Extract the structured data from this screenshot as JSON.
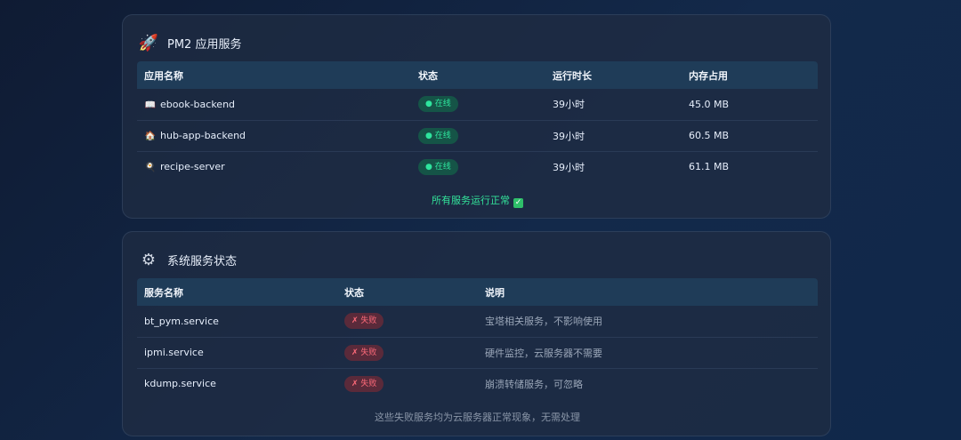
{
  "pm2": {
    "title": "PM2 应用服务",
    "icon": "rocket-icon",
    "columns": [
      "应用名称",
      "状态",
      "运行时长",
      "内存占用"
    ],
    "rows": [
      {
        "icon": "book-icon",
        "name": "ebook-backend",
        "status": "● 在线",
        "uptime": "39小时",
        "memory": "45.0 MB"
      },
      {
        "icon": "house-icon",
        "name": "hub-app-backend",
        "status": "● 在线",
        "uptime": "39小时",
        "memory": "60.5 MB"
      },
      {
        "icon": "recipe-icon",
        "name": "recipe-server",
        "status": "● 在线",
        "uptime": "39小时",
        "memory": "61.1 MB"
      }
    ],
    "footer": "所有服务运行正常",
    "status_color": "#2ee59d"
  },
  "system": {
    "title": "系统服务状态",
    "icon": "gear-icon",
    "columns": [
      "服务名称",
      "状态",
      "说明"
    ],
    "rows": [
      {
        "name": "bt_pym.service",
        "status": "✗ 失败",
        "desc": "宝塔相关服务，不影响使用"
      },
      {
        "name": "ipmi.service",
        "status": "✗ 失败",
        "desc": "硬件监控，云服务器不需要"
      },
      {
        "name": "kdump.service",
        "status": "✗ 失败",
        "desc": "崩溃转储服务，可忽略"
      }
    ],
    "footer": "这些失败服务均为云服务器正常现象，无需处理",
    "status_color": "#ff6b7a"
  }
}
